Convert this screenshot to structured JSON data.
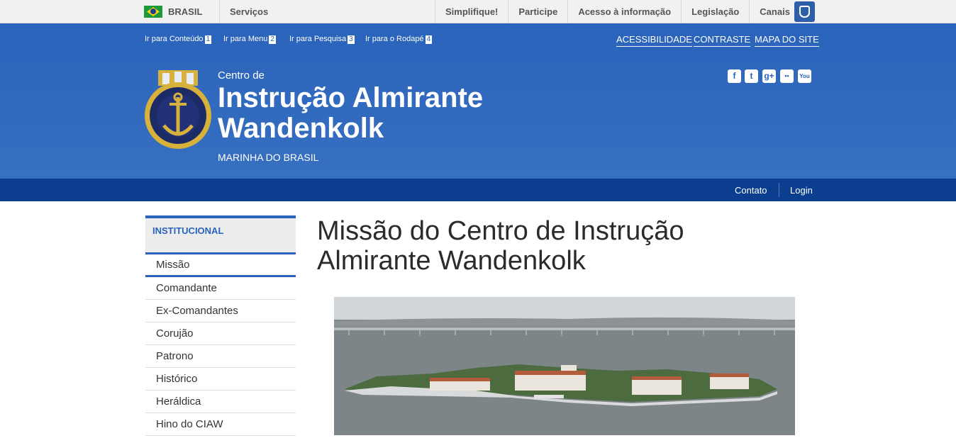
{
  "gov_bar": {
    "country": "BRASIL",
    "services": "Serviços",
    "links": [
      "Simplifique!",
      "Participe",
      "Acesso à informação",
      "Legislação",
      "Canais"
    ]
  },
  "skip_links": [
    {
      "label": "Ir para Conteúdo",
      "num": "1"
    },
    {
      "label": "Ir para Menu",
      "num": "2"
    },
    {
      "label": "Ir para Pesquisa",
      "num": "3"
    },
    {
      "label": "Ir para o Rodapé",
      "num": "4"
    }
  ],
  "accessibility_links": [
    "ACESSIBILIDADE",
    "CONTRASTE",
    "MAPA DO SITE"
  ],
  "social": {
    "facebook": "f",
    "twitter": "t",
    "googleplus": "g+",
    "flickr": "••",
    "youtube": "You"
  },
  "site": {
    "prefix": "Centro de",
    "title": "Instrução Almirante Wandenkolk",
    "subtitle": "MARINHA DO BRASIL"
  },
  "service_links": {
    "contato": "Contato",
    "login": "Login"
  },
  "sidebar": {
    "heading": "INSTITUCIONAL",
    "items": [
      "Missão",
      "Comandante",
      "Ex-Comandantes",
      "Corujão",
      "Patrono",
      "Histórico",
      "Heráldica",
      "Hino do CIAW"
    ]
  },
  "main": {
    "title": "Missão do Centro de Instrução Almirante Wandenkolk"
  },
  "colors": {
    "primary": "#2a63bb",
    "dark": "#0b3e8e",
    "gov_bar": "#f1f1f1"
  }
}
